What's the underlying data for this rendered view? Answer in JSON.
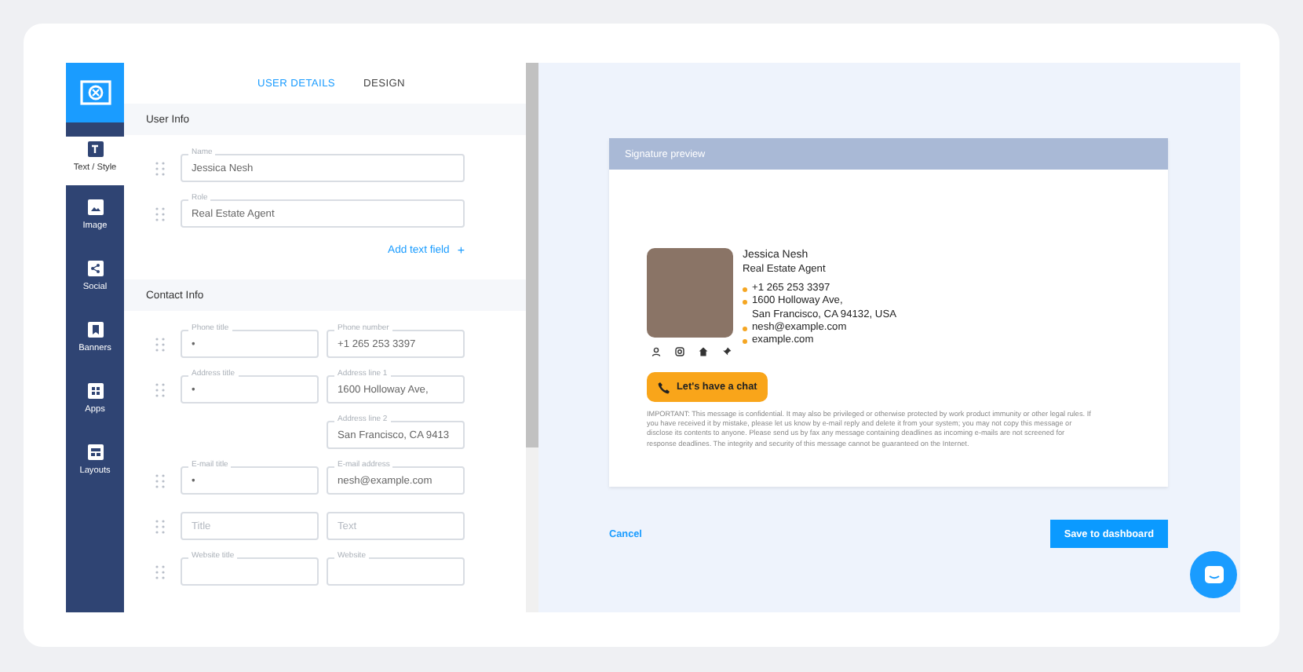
{
  "sidebar": {
    "items": [
      {
        "label": "Text / Style",
        "kind": "text",
        "selected": true
      },
      {
        "label": "Image",
        "kind": "image",
        "selected": false
      },
      {
        "label": "Social",
        "kind": "share",
        "selected": false
      },
      {
        "label": "Banners",
        "kind": "bookmark",
        "selected": false
      },
      {
        "label": "Apps",
        "kind": "grid",
        "selected": false
      },
      {
        "label": "Layouts",
        "kind": "layout",
        "selected": false
      }
    ]
  },
  "tabs": [
    {
      "label": "USER DETAILS",
      "selected": true
    },
    {
      "label": "DESIGN",
      "selected": false
    }
  ],
  "sections": [
    {
      "title": "User Info",
      "rows": [
        {
          "kind": "single",
          "fields": [
            {
              "label": "Name",
              "value": "Jessica Nesh"
            }
          ]
        },
        {
          "kind": "single",
          "fields": [
            {
              "label": "Role",
              "value": "Real Estate Agent"
            }
          ]
        }
      ],
      "add_link": {
        "label": "Add text field",
        "icon": "+"
      }
    },
    {
      "title": "Contact Info",
      "rows": [
        {
          "kind": "pair",
          "fields": [
            {
              "label": "Phone title",
              "value": "•"
            },
            {
              "label": "Phone number",
              "value": "+1 265 253 3397"
            }
          ]
        },
        {
          "kind": "pair",
          "fields": [
            {
              "label": "Address title",
              "value": "•"
            },
            {
              "label": "Address line 1",
              "value": "1600 Holloway Ave,"
            }
          ]
        },
        {
          "kind": "continuation",
          "fields": [
            {
              "label": "Address line 2",
              "value": "San Francisco, CA 9413"
            }
          ]
        },
        {
          "kind": "pair",
          "fields": [
            {
              "label": "E-mail title",
              "value": "•"
            },
            {
              "label": "E-mail address",
              "value": "nesh@example.com"
            }
          ]
        },
        {
          "kind": "pair",
          "fields": [
            {
              "placeholder": "Title"
            },
            {
              "placeholder": "Text"
            }
          ]
        },
        {
          "kind": "pair",
          "fields": [
            {
              "label": "Website title"
            },
            {
              "label": "Website"
            }
          ]
        }
      ]
    }
  ],
  "preview": {
    "title": "Signature preview",
    "signature": {
      "name": "Jessica Nesh",
      "role": "Real Estate Agent",
      "contacts": [
        {
          "lines": [
            "+1 265 253 3397"
          ]
        },
        {
          "lines": [
            "1600 Holloway Ave,",
            "San Francisco, CA 94132, USA"
          ]
        },
        {
          "lines": [
            "nesh@example.com"
          ]
        },
        {
          "lines": [
            "example.com"
          ]
        }
      ],
      "button": "Let's have a chat",
      "disclaimer": "IMPORTANT: This message is confidential. It may also be privileged or otherwise protected by work product immunity or other legal rules. If you have received it by mistake, please let us know by e-mail reply and delete it from your system; you may not copy this message or disclose its contents to anyone. Please send us by fax any message containing deadlines as incoming e-mails are not screened for response deadlines. The integrity and security of this message cannot be guaranteed on the Internet."
    }
  },
  "actions": {
    "cancel": "Cancel",
    "save": "Save to dashboard"
  }
}
